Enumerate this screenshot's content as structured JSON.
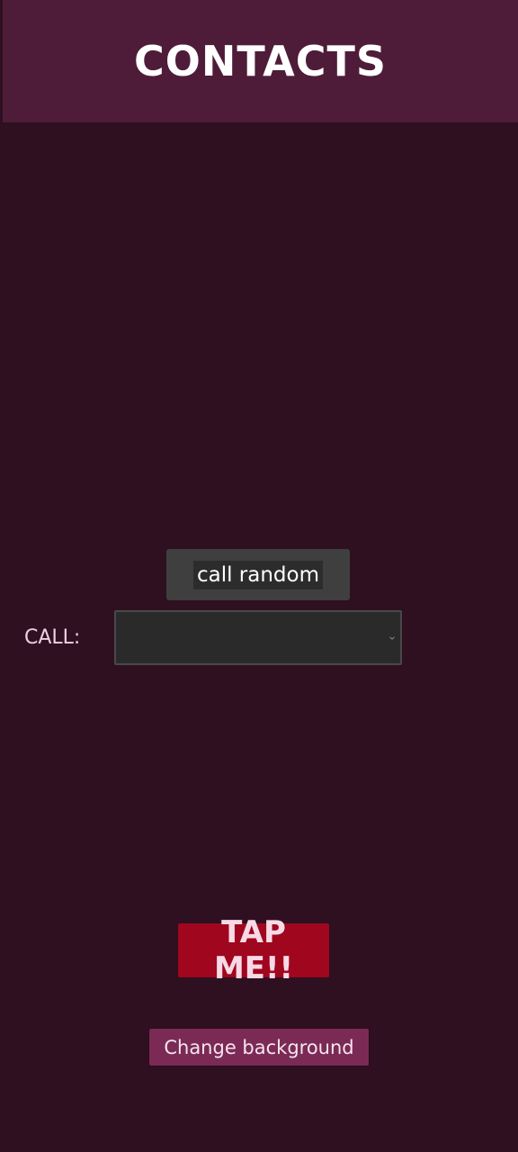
{
  "header": {
    "title": "CONTACTS"
  },
  "main": {
    "call_random_label": "call random",
    "call_label": "CALL:",
    "call_select": {
      "selected_value": "",
      "icon": "chevron-down-icon"
    },
    "tap_me_label": "TAP ME!!",
    "change_background_label": "Change background"
  },
  "colors": {
    "background": "#2e1020",
    "header_background": "#4e1c38",
    "tap_me_background": "#a0061d",
    "change_background_button": "#7b2a55"
  }
}
